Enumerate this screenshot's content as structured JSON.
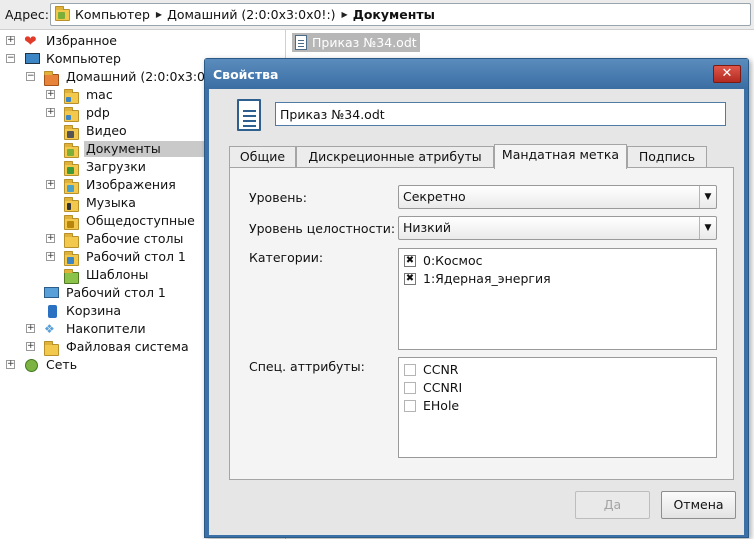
{
  "address": {
    "label": "Адрес:",
    "crumbs": [
      "Компьютер",
      "Домашний (2:0:0x3:0x0!:)",
      "Документы"
    ]
  },
  "tree": {
    "items": [
      {
        "label": "Избранное",
        "icon": "heart-icon"
      },
      {
        "label": "Компьютер",
        "icon": "computer-icon"
      },
      {
        "label": "Домашний (2:0:0x3:0x0!:)",
        "icon": "home-icon"
      },
      {
        "label": "mac",
        "icon": "folder-icon"
      },
      {
        "label": "pdp",
        "icon": "folder-icon"
      },
      {
        "label": "Видео",
        "icon": "video-folder-icon"
      },
      {
        "label": "Документы",
        "icon": "documents-folder-icon"
      },
      {
        "label": "Загрузки",
        "icon": "downloads-folder-icon"
      },
      {
        "label": "Изображения",
        "icon": "pictures-folder-icon"
      },
      {
        "label": "Музыка",
        "icon": "music-folder-icon"
      },
      {
        "label": "Общедоступные",
        "icon": "public-folder-icon"
      },
      {
        "label": "Рабочие столы",
        "icon": "folder-icon"
      },
      {
        "label": "Рабочий стол 1",
        "icon": "desktop-folder-icon"
      },
      {
        "label": "Шаблоны",
        "icon": "templates-folder-icon"
      },
      {
        "label": "Рабочий стол 1",
        "icon": "desktop-icon"
      },
      {
        "label": "Корзина",
        "icon": "trash-icon"
      },
      {
        "label": "Накопители",
        "icon": "drives-icon"
      },
      {
        "label": "Файловая система",
        "icon": "folder-icon"
      },
      {
        "label": "Сеть",
        "icon": "network-icon"
      }
    ],
    "selected": "Документы"
  },
  "files": {
    "selected_file": "Приказ №34.odt"
  },
  "dialog": {
    "title": "Свойства",
    "close_glyph": "✕",
    "filename": "Приказ №34.odt",
    "tabs": [
      "Общие",
      "Дискреционные атрибуты",
      "Мандатная метка",
      "Подпись"
    ],
    "active_tab": "Мандатная метка",
    "level_label": "Уровень:",
    "level_value": "Секретно",
    "integrity_label": "Уровень целостности:",
    "integrity_value": "Низкий",
    "categories_label": "Категории:",
    "categories": [
      {
        "label": "0:Космос",
        "checked": true
      },
      {
        "label": "1:Ядерная_энергия",
        "checked": true
      }
    ],
    "special_label": "Спец. аттрибуты:",
    "special_attrs": [
      {
        "label": "CCNR",
        "checked": false
      },
      {
        "label": "CCNRI",
        "checked": false
      },
      {
        "label": "EHole",
        "checked": false
      }
    ],
    "ok_label": "Да",
    "cancel_label": "Отмена",
    "ok_enabled": false
  },
  "colors": {
    "title_bar": "#3b71a6",
    "close_button": "#c63a2e",
    "selection": "#c9c9c9",
    "folder": "#f2c94c"
  }
}
